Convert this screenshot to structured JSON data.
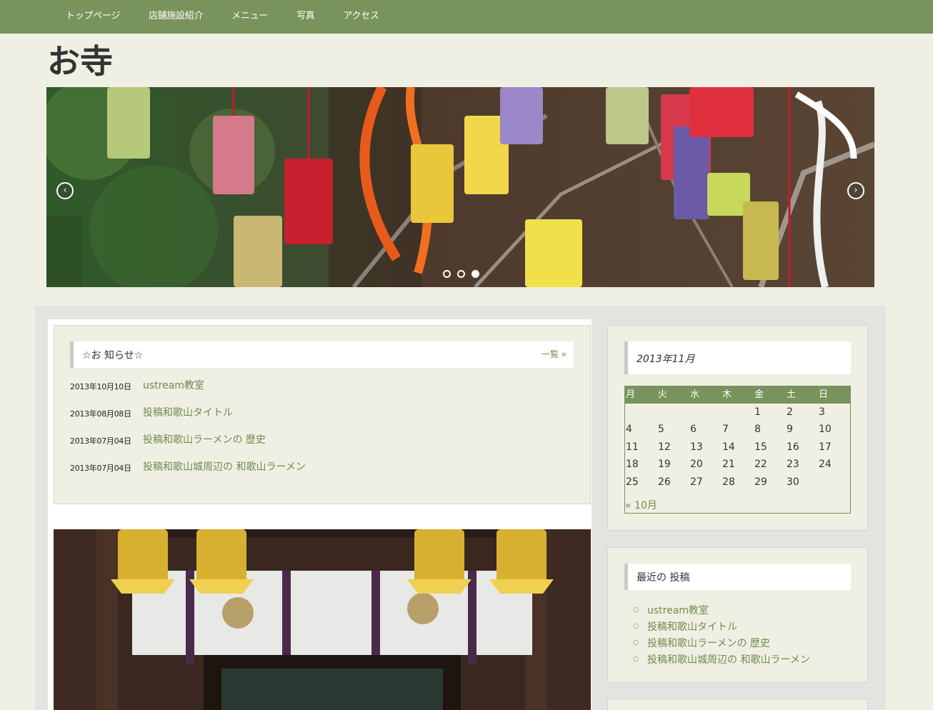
{
  "nav": {
    "items": [
      "トップページ",
      "店舗施設紹介",
      "メニュー",
      "写真",
      "アクセス"
    ]
  },
  "site": {
    "title": "お寺"
  },
  "slider": {
    "prev_icon": "chevron-left-icon",
    "next_icon": "chevron-right-icon",
    "slide_count": 3,
    "active_index": 2
  },
  "news": {
    "title": "☆お 知らせ☆",
    "more_label": "一覧 »",
    "items": [
      {
        "date": "2013年10月10日",
        "title": "ustream教室"
      },
      {
        "date": "2013年08月08日",
        "title": "投稿和歌山タイトル"
      },
      {
        "date": "2013年07月04日",
        "title": "投稿和歌山ラーメンの 歴史"
      },
      {
        "date": "2013年07月04日",
        "title": "投稿和歌山城周辺の 和歌山ラーメン"
      }
    ]
  },
  "calendar": {
    "caption": "2013年11月",
    "weekdays": [
      "月",
      "火",
      "水",
      "木",
      "金",
      "土",
      "日"
    ],
    "weeks": [
      [
        "",
        "",
        "",
        "",
        "1",
        "2",
        "3"
      ],
      [
        "4",
        "5",
        "6",
        "7",
        "8",
        "9",
        "10"
      ],
      [
        "11",
        "12",
        "13",
        "14",
        "15",
        "16",
        "17"
      ],
      [
        "18",
        "19",
        "20",
        "21",
        "22",
        "23",
        "24"
      ],
      [
        "25",
        "26",
        "27",
        "28",
        "29",
        "30",
        ""
      ]
    ],
    "prev_link": "« 10月"
  },
  "recent": {
    "title": "最近の 投稿",
    "bullet": "○",
    "items": [
      "ustream教室",
      "投稿和歌山タイトル",
      "投稿和歌山ラーメンの 歴史",
      "投稿和歌山城周辺の 和歌山ラーメン"
    ]
  },
  "colors": {
    "accent": "#78935b",
    "link": "#6e8a4f",
    "background": "#f0efe4"
  }
}
